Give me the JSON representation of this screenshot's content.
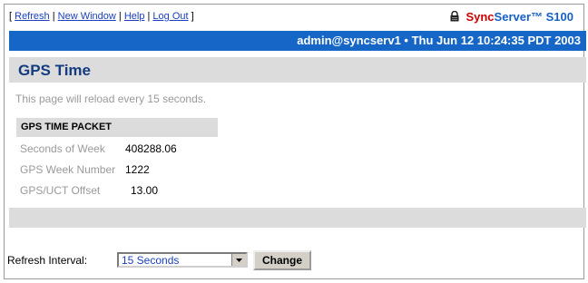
{
  "header": {
    "links": [
      "Refresh",
      "New Window",
      "Help",
      "Log Out"
    ],
    "brand": {
      "sync": "Sync",
      "server": "Server™ S100"
    }
  },
  "status_bar": {
    "text": "admin@syncserv1 • Thu Jun 12 10:24:35 PDT 2003"
  },
  "page": {
    "title": "GPS Time",
    "reload_note": "This page will reload every 15 seconds."
  },
  "packet": {
    "heading": "GPS TIME PACKET",
    "rows": [
      {
        "label": "Seconds of Week",
        "value": "408288.06"
      },
      {
        "label": "GPS Week Number",
        "value": "1222"
      },
      {
        "label": "GPS/UCT Offset",
        "value": "13.00"
      }
    ]
  },
  "refresh": {
    "label": "Refresh Interval:",
    "selected": "15 Seconds",
    "button": "Change"
  },
  "colors": {
    "header_blue": "#1566c6",
    "title_text": "#143c80",
    "brand_red": "#cc0000",
    "brand_blue": "#1560c8"
  },
  "icons": {
    "brand": "lock-icon",
    "dropdown": "chevron-down-icon"
  }
}
